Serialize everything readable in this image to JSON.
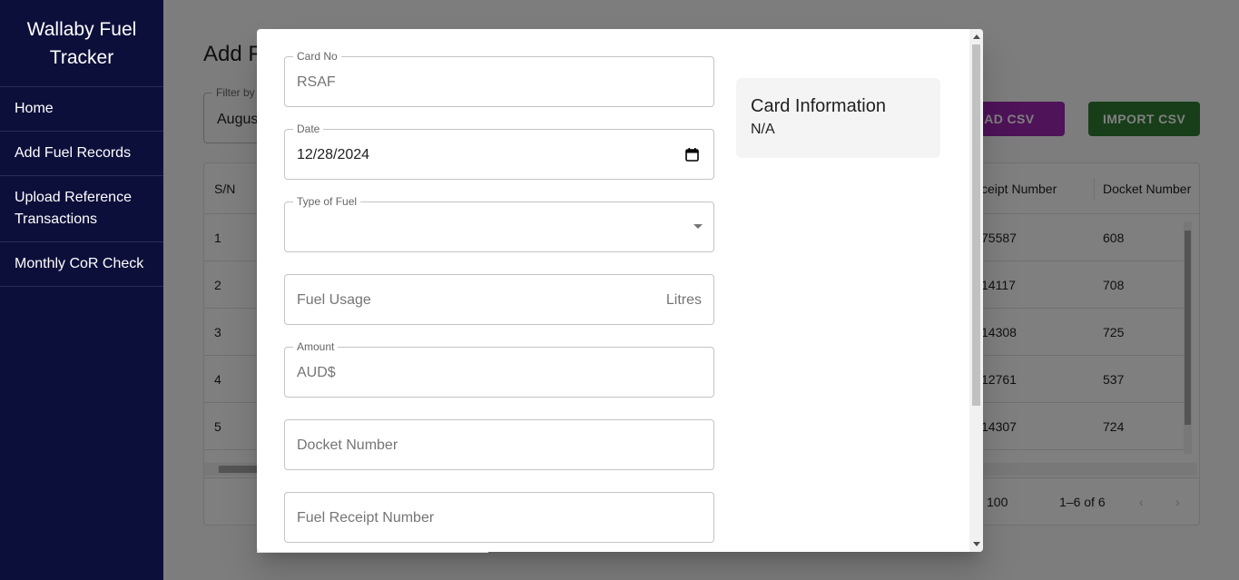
{
  "app": {
    "title": "Wallaby Fuel Tracker"
  },
  "sidebar": {
    "items": [
      {
        "label": "Home"
      },
      {
        "label": "Add Fuel Records"
      },
      {
        "label": "Upload Reference Transactions"
      },
      {
        "label": "Monthly CoR Check"
      }
    ]
  },
  "main": {
    "title_partial": "Add F",
    "filter": {
      "label": "Filter by",
      "value": "Augus"
    },
    "download_button": "NLOAD CSV",
    "import_button": "IMPORT CSV",
    "grid": {
      "headers": {
        "sn": "S/N",
        "receipt": "ceipt Number",
        "docket": "Docket Number"
      },
      "rows": [
        {
          "sn": "1",
          "receipt": "75587",
          "docket": "608"
        },
        {
          "sn": "2",
          "receipt": "14117",
          "docket": "708"
        },
        {
          "sn": "3",
          "receipt": "14308",
          "docket": "725"
        },
        {
          "sn": "4",
          "receipt": "12761",
          "docket": "537"
        },
        {
          "sn": "5",
          "receipt": "14307",
          "docket": "724"
        }
      ],
      "footer": {
        "rows_per_page": "100",
        "range": "1–6 of 6"
      }
    }
  },
  "dialog": {
    "fields": {
      "card_no": {
        "label": "Card No",
        "value": "RSAF"
      },
      "date": {
        "label": "Date",
        "value": "12/28/2024"
      },
      "fuel_type": {
        "label": "Type of Fuel",
        "value": ""
      },
      "fuel_usage": {
        "placeholder": "Fuel Usage",
        "unit": "Litres"
      },
      "amount": {
        "label": "Amount",
        "prefix": "AUD$"
      },
      "docket_number": {
        "placeholder": "Docket Number"
      },
      "fuel_receipt_number": {
        "placeholder": "Fuel Receipt Number"
      }
    },
    "card_info": {
      "title": "Card Information",
      "value": "N/A"
    }
  },
  "colors": {
    "sidebar_bg": "#0d0f3b",
    "download_button": "#9c27b0",
    "import_button": "#2e7d32",
    "backdrop": "rgba(0,0,0,0.5)"
  },
  "icons": [
    "calendar-icon",
    "dropdown-caret-icon",
    "chevron-left-icon",
    "chevron-right-icon",
    "scroll-up-arrow-icon",
    "scroll-down-arrow-icon"
  ]
}
